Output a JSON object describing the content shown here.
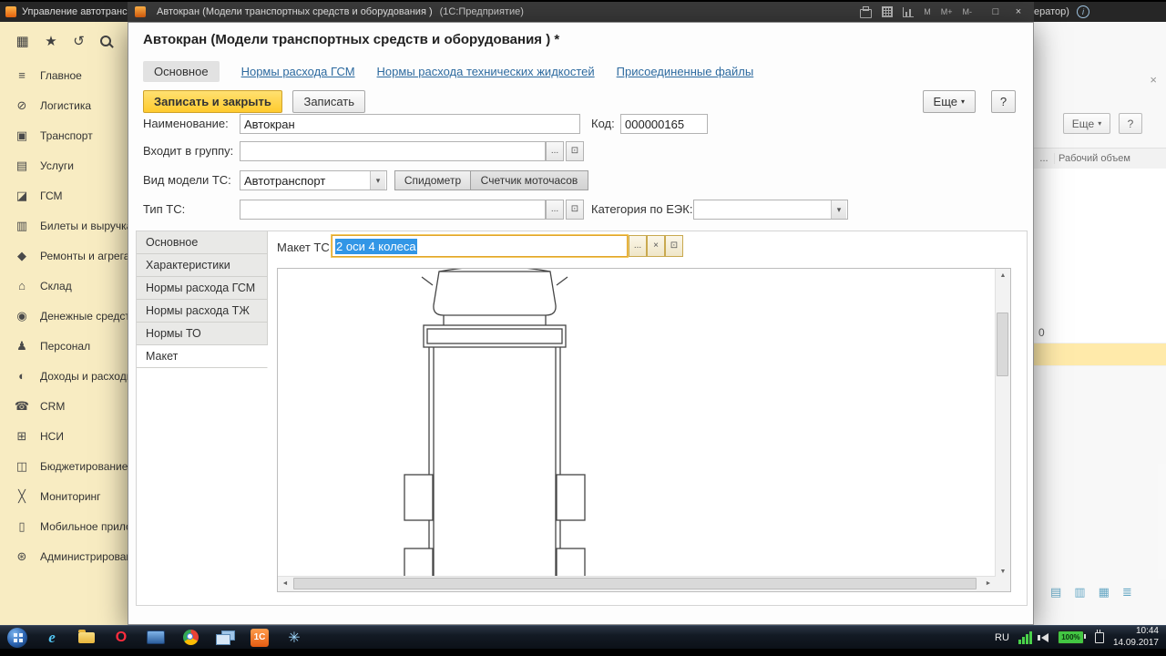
{
  "glyphs": {
    "dropdown": "▾",
    "up": "▲",
    "down": "▼",
    "left": "◄",
    "right": "►",
    "maximize": "□",
    "close": "×",
    "info": "i",
    "open": "⊡",
    "ellipsis": "...",
    "clear": "×"
  },
  "top_bar": {
    "bg_app_title": "Управление автотранспортом",
    "dialog_title": "Автокран (Модели транспортных средств и оборудования )",
    "dialog_app_suffix": "(1С:Предприятие)",
    "memory_buttons": [
      "M",
      "M+",
      "M-"
    ],
    "right_fragment": "ератор)"
  },
  "sidebar": {
    "top_icons": [
      {
        "name": "apps-grid-icon",
        "glyph": "▦"
      },
      {
        "name": "favorites-star-icon",
        "glyph": "★"
      },
      {
        "name": "history-icon",
        "glyph": "↺"
      }
    ],
    "items": [
      {
        "label": "Главное",
        "glyph": "≡"
      },
      {
        "label": "Логистика",
        "glyph": "⊘"
      },
      {
        "label": "Транспорт",
        "glyph": "▣"
      },
      {
        "label": "Услуги",
        "glyph": "▤"
      },
      {
        "label": "ГСМ",
        "glyph": "◪"
      },
      {
        "label": "Билеты и выручка",
        "glyph": "▥"
      },
      {
        "label": "Ремонты и агрегаты",
        "glyph": "◆"
      },
      {
        "label": "Склад",
        "glyph": "⌂"
      },
      {
        "label": "Денежные средства",
        "glyph": "◉"
      },
      {
        "label": "Персонал",
        "glyph": "♟"
      },
      {
        "label": "Доходы и расходы",
        "glyph": "◐"
      },
      {
        "label": "CRM",
        "glyph": "☎"
      },
      {
        "label": "НСИ",
        "glyph": "⊞"
      },
      {
        "label": "Бюджетирование",
        "glyph": "◫"
      },
      {
        "label": "Мониторинг",
        "glyph": "╳"
      },
      {
        "label": "Мобильное приложение",
        "glyph": "▯"
      },
      {
        "label": "Администрирование",
        "glyph": "⊛"
      }
    ]
  },
  "dialog": {
    "heading": "Автокран (Модели транспортных средств и оборудования ) *",
    "tabs": [
      {
        "label": "Основное"
      },
      {
        "label": "Нормы расхода ГСМ"
      },
      {
        "label": "Нормы расхода технических жидкостей"
      },
      {
        "label": "Присоединенные файлы"
      }
    ],
    "toolbar": {
      "save_close": "Записать и закрыть",
      "save": "Записать",
      "more": "Еще",
      "help": "?"
    },
    "form": {
      "name_label": "Наименование:",
      "name_value": "Автокран",
      "code_label": "Код:",
      "code_value": "000000165",
      "group_label": "Входит в группу:",
      "group_value": "",
      "model_kind_label": "Вид модели ТС:",
      "model_kind_value": "Автотранспорт",
      "speedometer_btn": "Спидометр",
      "hours_btn": "Счетчик моточасов",
      "type_label": "Тип ТС:",
      "type_value": "",
      "eek_label": "Категория по ЕЭК:",
      "eek_value": ""
    },
    "inner_tabs": [
      {
        "label": "Основное"
      },
      {
        "label": "Характеристики"
      },
      {
        "label": "Нормы расхода ГСМ"
      },
      {
        "label": "Нормы расхода ТЖ"
      },
      {
        "label": "Нормы ТО"
      },
      {
        "label": "Макет"
      }
    ],
    "layout": {
      "label": "Макет ТС:",
      "value": "2 оси 4 колеса"
    }
  },
  "right_panel": {
    "more": "Еще",
    "help": "?",
    "col_dots": "...",
    "col_header": "Рабочий объем",
    "cell_zero": "0",
    "view_icons": [
      {
        "name": "view-list-icon",
        "glyph": "▤"
      },
      {
        "name": "view-rows-icon",
        "glyph": "▥"
      },
      {
        "name": "view-grid-icon",
        "glyph": "▦"
      },
      {
        "name": "view-lines-icon",
        "glyph": "≣"
      }
    ]
  },
  "taskbar": {
    "language": "RU",
    "battery": "100%",
    "time": "10:44",
    "date": "14.09.2017",
    "ie_glyph": "e",
    "opera_glyph": "O",
    "onec_glyph": "1С",
    "snow_glyph": "✳"
  }
}
